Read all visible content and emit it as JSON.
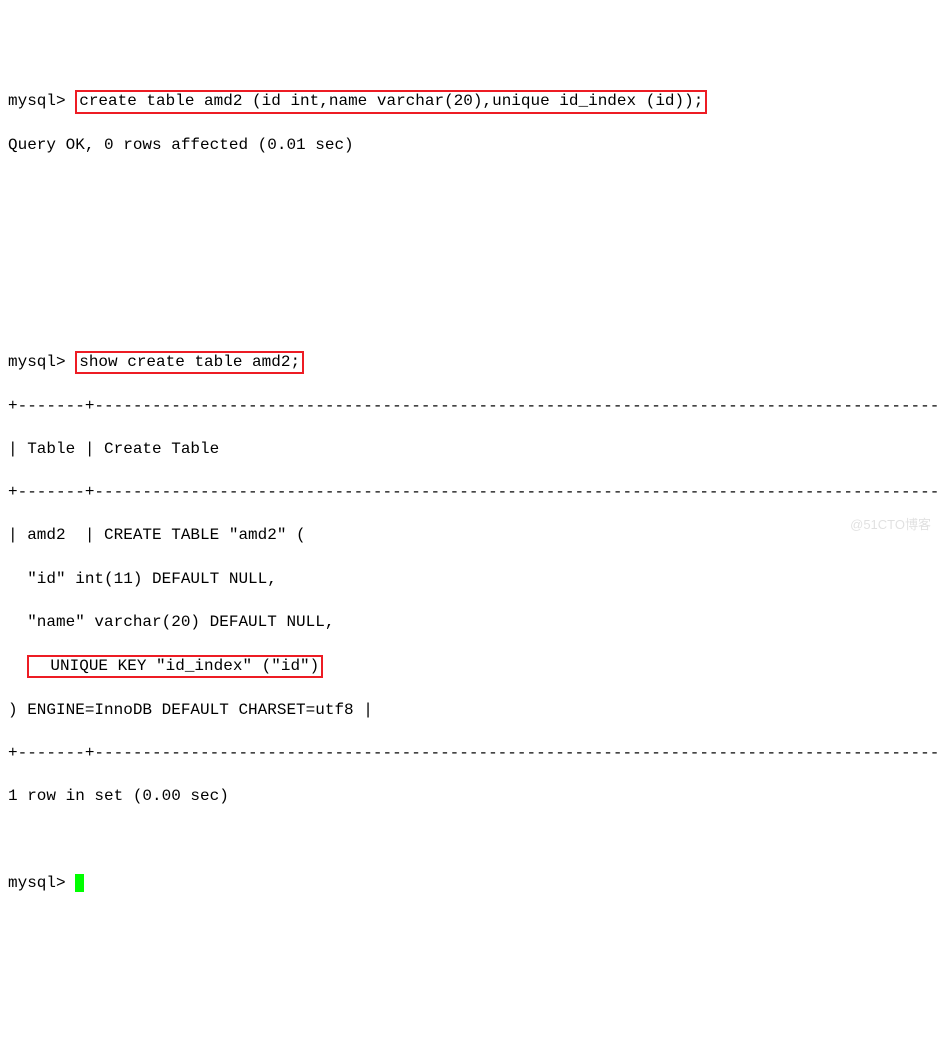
{
  "prompt": "mysql>",
  "cmd1": "create table amd2 (id int,name varchar(20),unique id_index (id));",
  "result1": "Query OK, 0 rows affected (0.01 sec)",
  "cmd2": "show create table amd2;",
  "sep_main": "+-------+-------------------------------------------------------------------------------------------------------------------------------------------+",
  "header_row": "| Table | Create Table                                                                                                                              |",
  "body_l1": "| amd2  | CREATE TABLE \"amd2\" (",
  "body_l2": "  \"id\" int(11) DEFAULT NULL,",
  "body_l3": "  \"name\" varchar(20) DEFAULT NULL,",
  "body_l4": "  UNIQUE KEY \"id_index\" (\"id\")",
  "body_l5": ") ENGINE=InnoDB DEFAULT CHARSET=utf8 |",
  "footer": "1 row in set (0.00 sec)",
  "watermark": "@51CTO博客"
}
